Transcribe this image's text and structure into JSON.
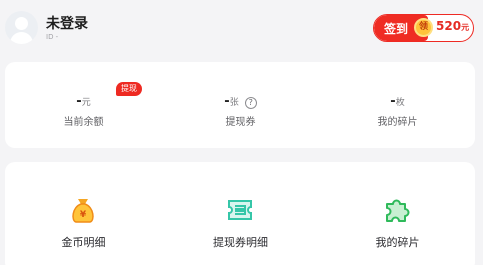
{
  "user": {
    "name": "未登录",
    "id_text": "ID -"
  },
  "signin": {
    "label": "签到",
    "badge": "领",
    "amount": "520",
    "unit": "元"
  },
  "stats": [
    {
      "value": "-",
      "unit": "元",
      "label": "当前余额",
      "badge": "提现"
    },
    {
      "value": "-",
      "unit": "张",
      "label": "提现券",
      "help": "?"
    },
    {
      "value": "-",
      "unit": "枚",
      "label": "我的碎片"
    }
  ],
  "entries": [
    {
      "label": "金币明细",
      "icon": "coin-bag-icon"
    },
    {
      "label": "提现券明细",
      "icon": "ticket-icon"
    },
    {
      "label": "我的碎片",
      "icon": "puzzle-icon"
    }
  ],
  "colors": {
    "accent": "#ef2c23",
    "coin": "#ffc43a",
    "ticket": "#35c6a8",
    "puzzle": "#2fba5b"
  }
}
